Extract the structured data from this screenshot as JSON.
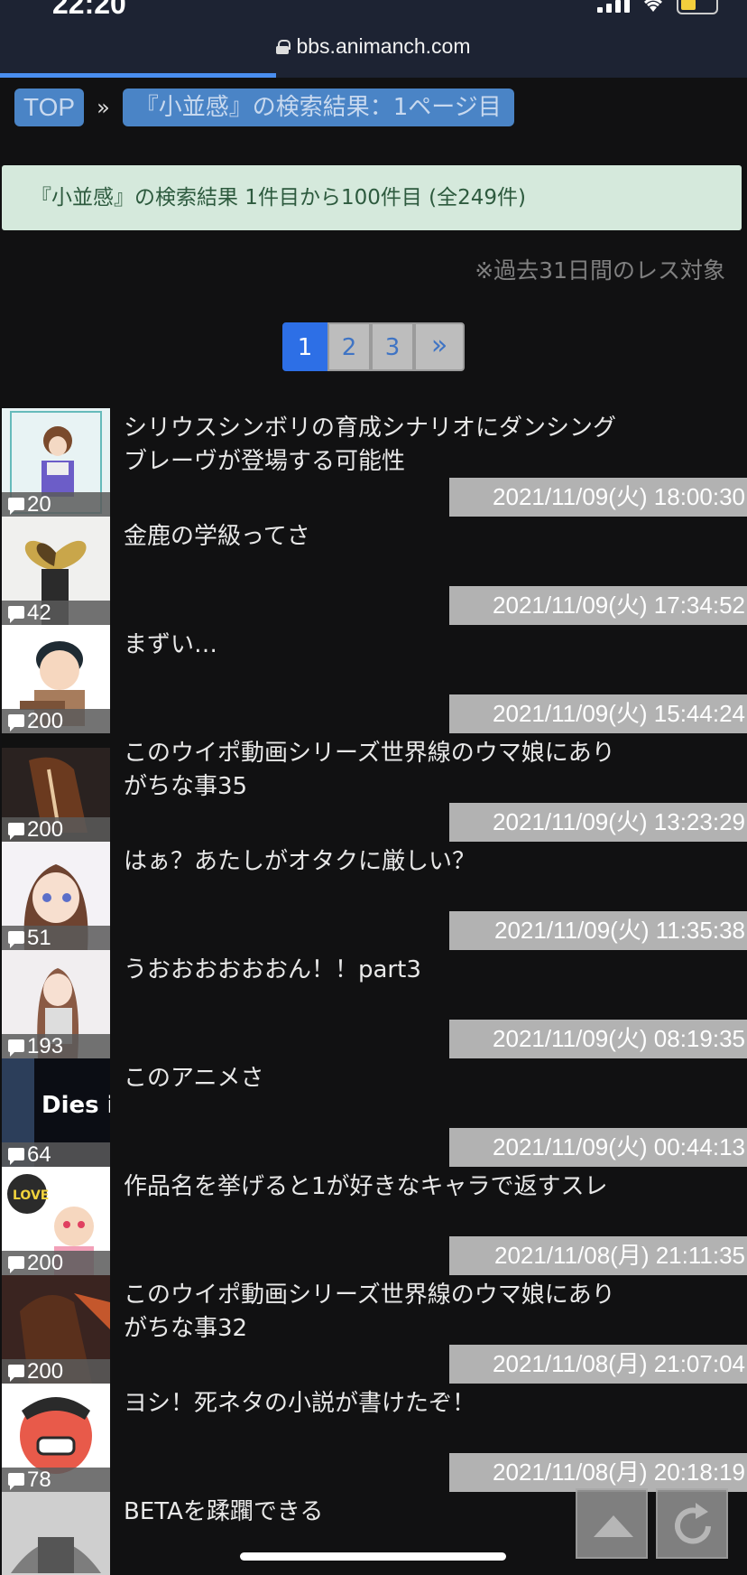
{
  "status_bar": {
    "time": "22:20"
  },
  "browser": {
    "url": "bbs.animanch.com",
    "load_progress_percent": 37
  },
  "breadcrumb": {
    "top": "TOP",
    "separator": "»",
    "current": "『小並感』の検索結果：1ページ目"
  },
  "result": {
    "summary": "『小並感』の検索結果 1件目から100件目 (全249件)",
    "note": "※過去31日間のレス対象"
  },
  "pager": {
    "pages": [
      "1",
      "2",
      "3"
    ],
    "next": "»",
    "current": "1"
  },
  "threads": [
    {
      "title": "シリウスシンボリの育成シナリオにダンシング\nブレーヴが登場する可能性",
      "count": "20",
      "date": "2021/11/09(火) 18:00:30"
    },
    {
      "title": "金鹿の学級ってさ",
      "count": "42",
      "date": "2021/11/09(火) 17:34:52"
    },
    {
      "title": "まずい…",
      "count": "200",
      "date": "2021/11/09(火) 15:44:24"
    },
    {
      "title": "このウイポ動画シリーズ世界線のウマ娘にあり\nがちな事35",
      "count": "200",
      "date": "2021/11/09(火) 13:23:29"
    },
    {
      "title": "はぁ？あたしがオタクに厳しい？",
      "count": "51",
      "date": "2021/11/09(火) 11:35:38"
    },
    {
      "title": "うおおおおおおん！！part3",
      "count": "193",
      "date": "2021/11/09(火) 08:19:35"
    },
    {
      "title": "このアニメさ",
      "count": "64",
      "date": "2021/11/09(火) 00:44:13"
    },
    {
      "title": "作品名を挙げると1が好きなキャラで返すスレ",
      "count": "200",
      "date": "2021/11/08(月) 21:11:35"
    },
    {
      "title": "このウイポ動画シリーズ世界線のウマ娘にあり\nがちな事32",
      "count": "200",
      "date": "2021/11/08(月) 21:07:04"
    },
    {
      "title": "ヨシ！死ネタの小説が書けたぞ！",
      "count": "78",
      "date": "2021/11/08(月) 20:18:19"
    },
    {
      "title": "BETAを蹂躙できる",
      "count": "",
      "date": ""
    }
  ],
  "colors": {
    "page_bg": "#111112",
    "accent_blue": "#4a84c6",
    "result_bg": "#d5e9dc",
    "date_bg": "#b2b2b2"
  },
  "icons": [
    "lock-icon",
    "comment-icon",
    "scroll-up-icon",
    "refresh-icon"
  ]
}
